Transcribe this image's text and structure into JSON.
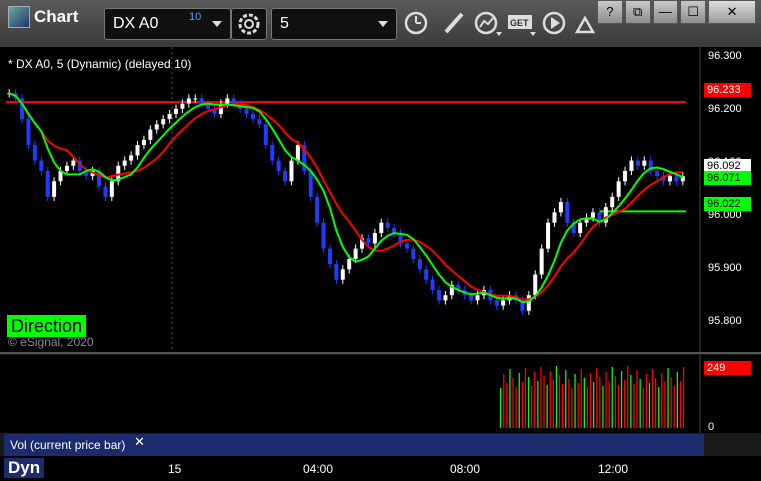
{
  "window": {
    "title": "Chart",
    "symbol": "DX A0",
    "symbol_count": "10",
    "interval": "5",
    "controls": [
      "?",
      "⧉",
      "—",
      "☐",
      "✕"
    ]
  },
  "chart": {
    "title": "* DX A0, 5 (Dynamic) (delayed 10)",
    "direction_label": "Direction",
    "copyright": "© eSignal, 2020",
    "price_axis": [
      "96.300",
      "96.200",
      "96.100",
      "96.000",
      "95.900",
      "95.800"
    ],
    "badges": {
      "red": "96.233",
      "last": "96.092",
      "green_ma": "96.071",
      "green": "96.022"
    },
    "colors": {
      "red": "#ff0000",
      "green": "#00ff00",
      "up": "#ffffff",
      "down": "#1f3cff"
    }
  },
  "volume": {
    "label": "Vol (current price bar)",
    "close": "✕",
    "max_label": "249",
    "zero_label": "0"
  },
  "bottom": {
    "dyn": "Dyn",
    "time_labels": [
      "15",
      "04:00",
      "08:00",
      "12:00"
    ]
  },
  "chart_data": {
    "type": "candlestick",
    "title": "* DX A0, 5 (Dynamic) (delayed 10)",
    "ylim": [
      95.76,
      96.32
    ],
    "closes": [
      96.25,
      96.24,
      96.2,
      96.15,
      96.12,
      96.1,
      96.05,
      96.08,
      96.1,
      96.11,
      96.12,
      96.1,
      96.09,
      96.1,
      96.07,
      96.05,
      96.08,
      96.11,
      96.12,
      96.13,
      96.15,
      96.16,
      96.18,
      96.19,
      96.2,
      96.21,
      96.22,
      96.23,
      96.24,
      96.24,
      96.23,
      96.22,
      96.21,
      96.23,
      96.24,
      96.23,
      96.22,
      96.21,
      96.2,
      96.19,
      96.15,
      96.12,
      96.1,
      96.08,
      96.12,
      96.15,
      96.1,
      96.05,
      96.0,
      95.95,
      95.92,
      95.89,
      95.91,
      95.93,
      95.95,
      95.97,
      95.96,
      95.98,
      96.0,
      95.99,
      95.98,
      95.96,
      95.95,
      95.93,
      95.91,
      95.89,
      95.87,
      95.85,
      95.86,
      95.88,
      95.87,
      95.86,
      95.85,
      95.86,
      95.87,
      95.85,
      95.84,
      95.85,
      95.86,
      95.85,
      95.83,
      95.86,
      95.9,
      95.95,
      96.0,
      96.02,
      96.04,
      96.0,
      95.98,
      96.0,
      96.01,
      96.02,
      96.0,
      96.03,
      96.05,
      96.08,
      96.1,
      96.12,
      96.11,
      96.12,
      96.1,
      96.09,
      96.08,
      96.09,
      96.08,
      96.09
    ],
    "red_line": 96.233,
    "green_line": 96.022,
    "volume_max": 249
  }
}
